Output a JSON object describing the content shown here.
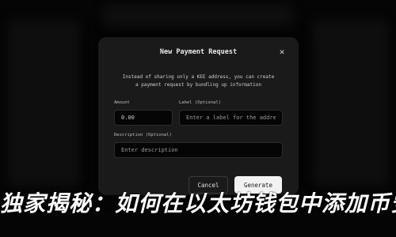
{
  "modal": {
    "title": "New Payment Request",
    "description_line1": "Instead of sharing only a KEE address, you can create",
    "description_line2": "a payment request by bundling up information",
    "amount": {
      "label": "Amount",
      "value": "0.00"
    },
    "label_field": {
      "label": "Label (Optional)",
      "placeholder": "Enter a label for the address"
    },
    "description_field": {
      "label": "Description (Optional)",
      "placeholder": "Enter description"
    },
    "buttons": {
      "cancel": "Cancel",
      "generate": "Generate"
    }
  },
  "background": {
    "headline": "独家揭秘：如何在以太坊钱包中添加币安链的"
  }
}
